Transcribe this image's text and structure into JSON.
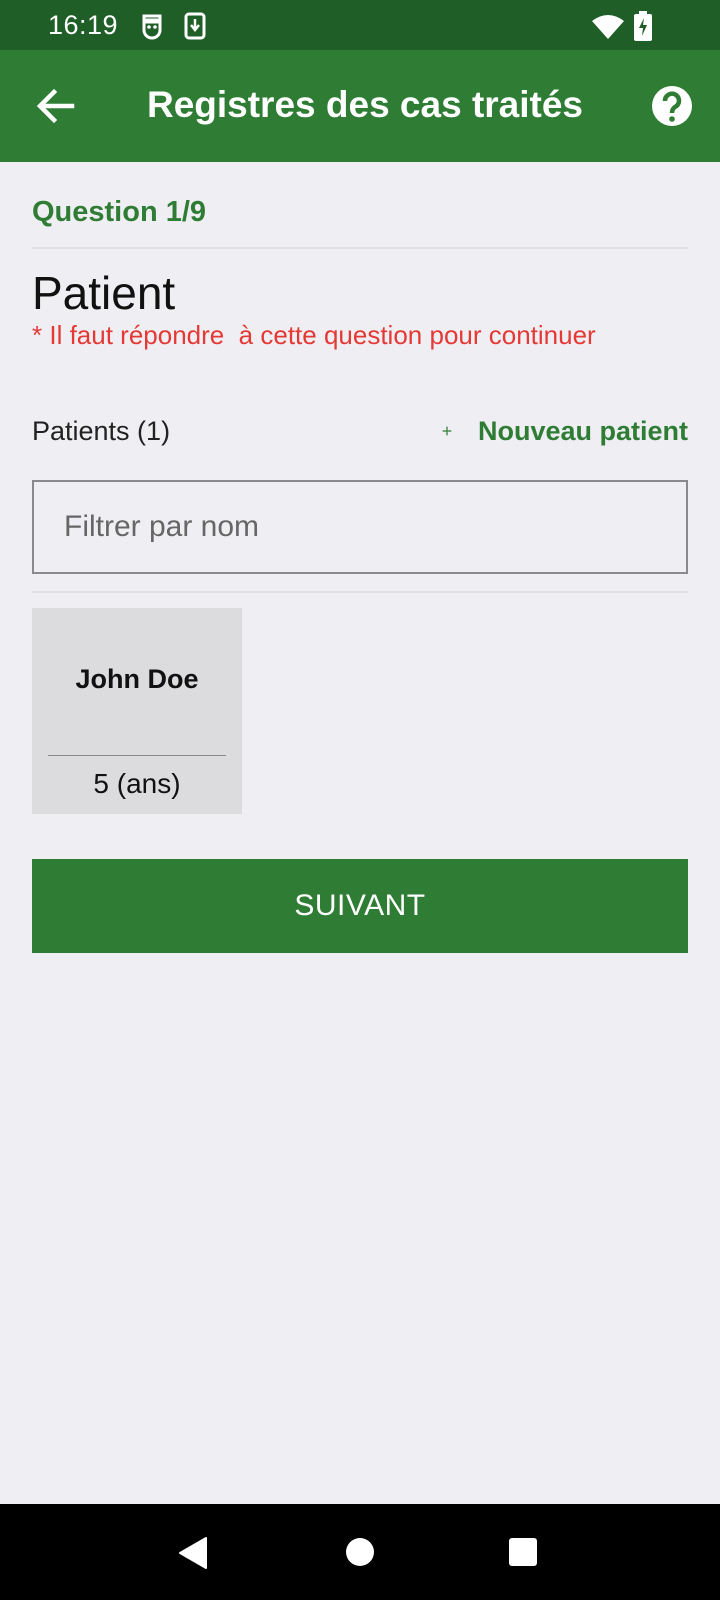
{
  "status_bar": {
    "time": "16:19",
    "icons": [
      "notification-face-icon",
      "download-icon",
      "wifi-icon",
      "battery-charging-icon"
    ],
    "background": "#1f5e27"
  },
  "app_bar": {
    "title": "Registres des cas traités",
    "back_icon": "arrow-back-icon",
    "help_icon": "help-circle-icon",
    "background": "#2f7d34"
  },
  "question": {
    "number": "Question 1/9",
    "title": "Patient",
    "required_message": "* Il faut répondre  à cette question pour continuer"
  },
  "patients": {
    "count_label": "Patients (1)",
    "new_patient_label": "Nouveau patient",
    "filter_placeholder": "Filtrer par nom",
    "filter_value": "",
    "items": [
      {
        "name": "John Doe",
        "age": "5 (ans)"
      }
    ]
  },
  "actions": {
    "next_label": "SUIVANT"
  },
  "colors": {
    "accent": "#2f7d34",
    "error": "#e53935",
    "background": "#efeef3",
    "card": "#dcdcde"
  }
}
